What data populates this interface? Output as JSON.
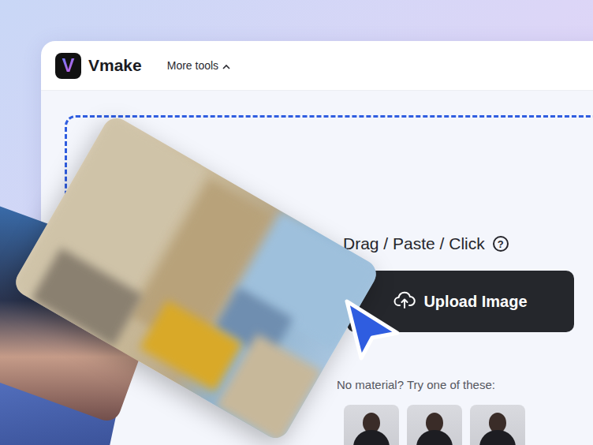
{
  "header": {
    "logo_letter": "V",
    "brand": "Vmake",
    "menu": {
      "label": "More tools",
      "expanded": true
    }
  },
  "upload": {
    "hint": "Drag / Paste / Click",
    "help": "?",
    "button": "Upload Image",
    "samples_label": "No material? Try one of these:"
  }
}
